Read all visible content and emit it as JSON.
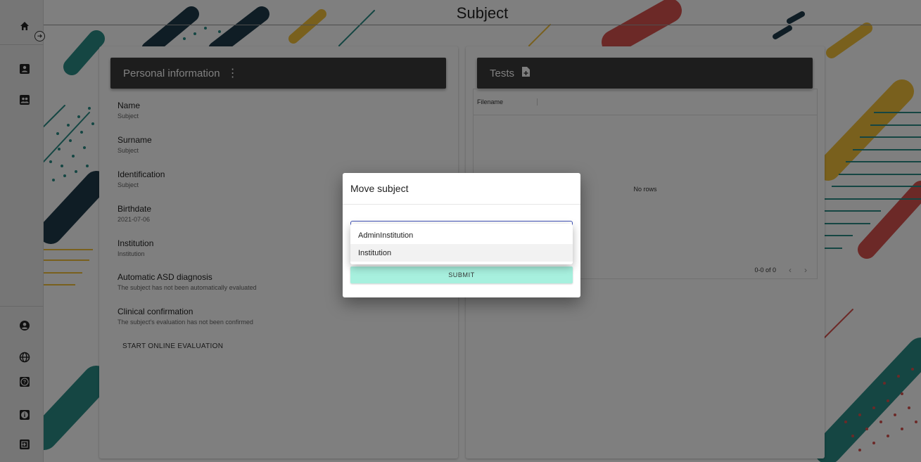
{
  "page": {
    "title": "Subject"
  },
  "sidebar": {
    "top": [
      {
        "name": "home-icon"
      },
      {
        "name": "person-icon"
      },
      {
        "name": "group-icon"
      }
    ],
    "bottom": [
      {
        "name": "account-circle-icon"
      },
      {
        "name": "globe-icon"
      },
      {
        "name": "help-icon"
      },
      {
        "name": "info-icon"
      },
      {
        "name": "logout-icon"
      }
    ],
    "expand_icon": "arrow-right-circle-icon"
  },
  "personal": {
    "header": "Personal information",
    "menu_icon": "⋮",
    "fields": [
      {
        "label": "Name",
        "value": "Subject"
      },
      {
        "label": "Surname",
        "value": "Subject"
      },
      {
        "label": "Identification",
        "value": "Subject"
      },
      {
        "label": "Birthdate",
        "value": "2021-07-06"
      },
      {
        "label": "Institution",
        "value": "Institution"
      },
      {
        "label": "Automatic ASD diagnosis",
        "value": "The subject has not been automatically evaluated"
      },
      {
        "label": "Clinical confirmation",
        "value": "The subject's evaluation has not been confirmed"
      }
    ],
    "start_button": "START ONLINE EVALUATION"
  },
  "tests": {
    "header": "Tests",
    "column_filename": "Filename",
    "empty": "No rows",
    "pagination": "0-0 of 0",
    "prev": "‹",
    "next": "›"
  },
  "dialog": {
    "title": "Move subject",
    "submit": "SUBMIT",
    "options": [
      "AdminInstitution",
      "Institution"
    ],
    "highlighted": "Institution"
  },
  "colors": {
    "header_bg": "#3a3a3a",
    "submit_bg": "#a7f0de",
    "focus_border": "#3f51b5",
    "teal": "#2a8c86",
    "red": "#d9534f",
    "yellow": "#f3c13a",
    "navy": "#1f3a4a"
  }
}
